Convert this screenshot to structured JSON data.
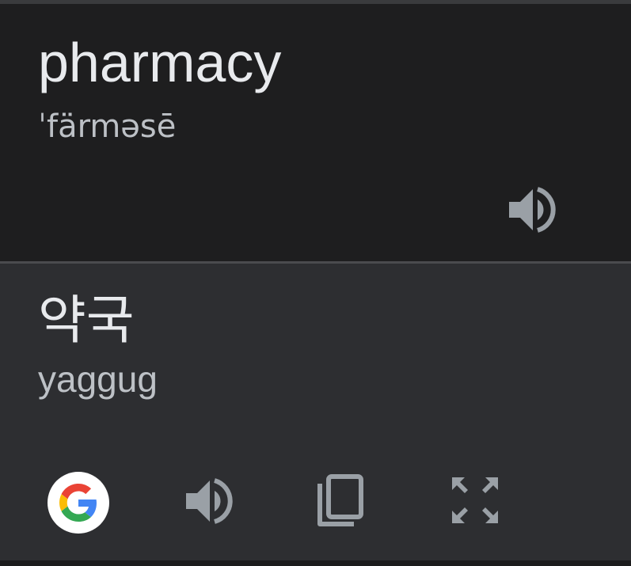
{
  "source": {
    "text": "pharmacy",
    "phonetic": "ˈfärməsē",
    "speak_icon": "volume-up-icon"
  },
  "target": {
    "text": "약국",
    "romanization": "yaggug"
  },
  "actions": [
    {
      "id": "search-google",
      "icon": "google-logo-icon"
    },
    {
      "id": "speak-translation",
      "icon": "volume-up-icon"
    },
    {
      "id": "copy-translation",
      "icon": "copy-icon"
    },
    {
      "id": "fullscreen",
      "icon": "fullscreen-icon"
    }
  ],
  "colors": {
    "source_bg": "#1e1e1f",
    "target_bg": "#2d2e31",
    "primary_text": "#e8eaed",
    "secondary_text": "#bdc1c6",
    "icon": "#9aa0a6"
  }
}
